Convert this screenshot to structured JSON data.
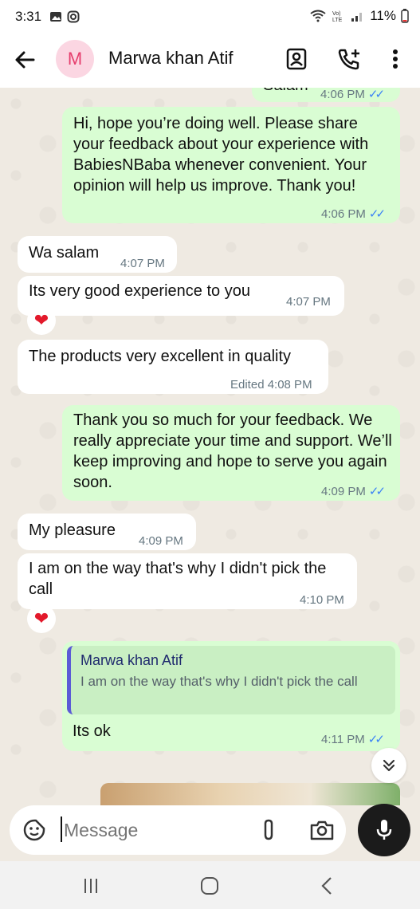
{
  "status_bar": {
    "time": "3:31",
    "battery": "11%"
  },
  "header": {
    "avatar_letter": "M",
    "contact_name": "Marwa khan Atif"
  },
  "messages": [
    {
      "text": "Salam",
      "time": "4:06 PM"
    },
    {
      "text": "Hi, hope you’re doing well. Please share your feedback about your experience with BabiesNBaba whenever convenient. Your opinion will help us improve. Thank you!",
      "time": "4:06 PM"
    },
    {
      "text": "Wa salam",
      "time": "4:07 PM"
    },
    {
      "text": "Its very good experience to you",
      "time": "4:07 PM"
    },
    {
      "text": "The products very excellent in quality",
      "time": "Edited 4:08 PM"
    },
    {
      "text": "Thank you so much for your feedback. We really appreciate your time and support. We’ll keep improving and hope to serve you again soon.",
      "time": "4:09 PM"
    },
    {
      "text": "My pleasure",
      "time": "4:09 PM"
    },
    {
      "text": "I am on the way that's why I didn't pick the call",
      "time": "4:10 PM"
    },
    {
      "text": "Its ok",
      "time": "4:11 PM",
      "quote_name": "Marwa khan Atif",
      "quote_text": "I am on the way that's why I didn't pick the call"
    }
  ],
  "reaction": "❤",
  "composer": {
    "placeholder": "Message"
  },
  "ticks": "✓✓",
  "colors": {
    "outgoing": "#d9fdd3",
    "incoming": "#ffffff",
    "ticks": "#3b82f6",
    "background": "#efeae2"
  }
}
